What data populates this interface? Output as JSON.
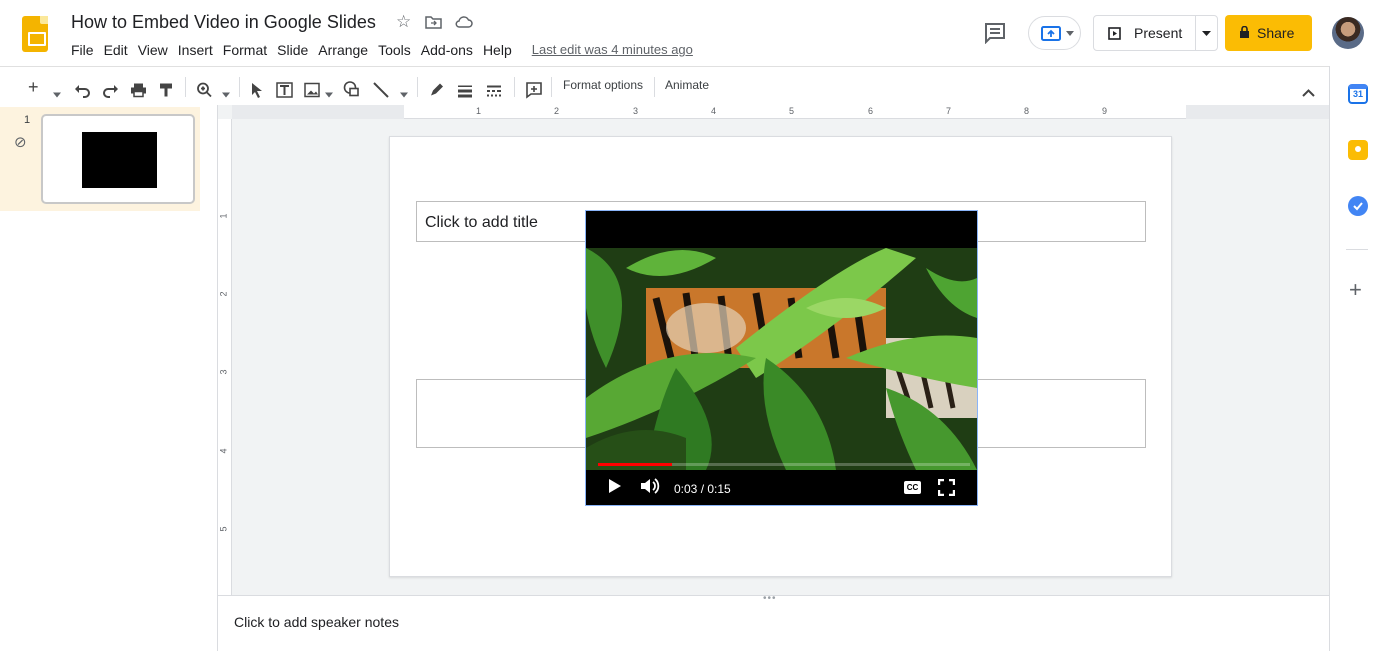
{
  "header": {
    "doc_title": "How to Embed Video in Google Slides",
    "last_edit": "Last edit was 4 minutes ago",
    "menu": [
      "File",
      "Edit",
      "View",
      "Insert",
      "Format",
      "Slide",
      "Arrange",
      "Tools",
      "Add-ons",
      "Help"
    ],
    "present_label": "Present",
    "share_label": "Share"
  },
  "toolbar": {
    "format_options": "Format options",
    "animate": "Animate"
  },
  "filmstrip": {
    "slides": [
      {
        "number": "1"
      }
    ]
  },
  "ruler": {
    "horizontal": [
      "1",
      "2",
      "3",
      "4",
      "5",
      "6",
      "7",
      "8",
      "9"
    ],
    "vertical": [
      "1",
      "2",
      "3",
      "4",
      "5"
    ]
  },
  "slide": {
    "title_placeholder": "Click to add title"
  },
  "video": {
    "time": "0:03 / 0:15",
    "progress": 0.2,
    "cc_label": "CC"
  },
  "notes": {
    "placeholder": "Click to add speaker notes"
  },
  "colors": {
    "share": "#fbbc04",
    "logo": "#f4b400",
    "filmstrip_active": "#fdf3df",
    "progress": "#ff0000"
  }
}
